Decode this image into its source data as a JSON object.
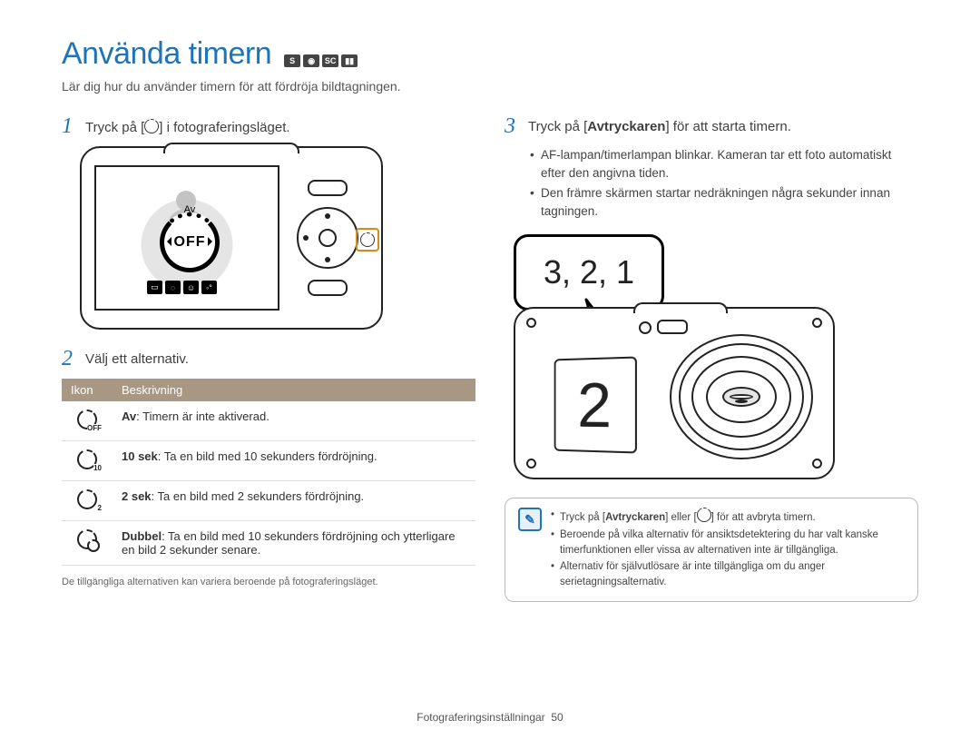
{
  "header": {
    "title": "Använda timern",
    "mode_icons": [
      "SMART",
      "camera-icon",
      "SCENE",
      "video-icon"
    ]
  },
  "intro": "Lär dig hur du använder timern för att fördröja bildtagningen.",
  "steps": {
    "s1": {
      "num": "1",
      "pre": "Tryck på [",
      "post": "] i fotograferingsläget."
    },
    "s2": {
      "num": "2",
      "text": "Välj ett alternativ."
    },
    "s3": {
      "num": "3",
      "pre": "Tryck på [",
      "bold": "Avtryckaren",
      "post": "] för att starta timern."
    }
  },
  "camera_back": {
    "av_label": "Av",
    "off_label": "OFF",
    "right_button_glyph": "t"
  },
  "bullets3": [
    "AF-lampan/timerlampan blinkar. Kameran tar ett foto automatiskt efter den angivna tiden.",
    "Den främre skärmen startar nedräkningen några sekunder innan tagningen."
  ],
  "countdown_bubble": "3, 2, 1",
  "front_display_value": "2",
  "table": {
    "headers": [
      "Ikon",
      "Beskrivning"
    ],
    "rows": [
      {
        "icon_sub": "OFF",
        "label": "Av",
        "desc": ": Timern är inte aktiverad."
      },
      {
        "icon_sub": "10",
        "label": "10 sek",
        "desc": ": Ta en bild med 10 sekunders fördröjning."
      },
      {
        "icon_sub": "2",
        "label": "2 sek",
        "desc": ": Ta en bild med 2 sekunders fördröjning."
      },
      {
        "icon_sub": "dbl",
        "label": "Dubbel",
        "desc": ": Ta en bild med 10 sekunders fördröjning och ytterligare en bild 2 sekunder senare."
      }
    ]
  },
  "footnote_left": "De tillgängliga alternativen kan variera beroende på fotograferingsläget.",
  "note": {
    "items": [
      {
        "pre": "Tryck på [",
        "bold": "Avtryckaren",
        "mid": "] eller [",
        "post": "] för att avbryta timern."
      },
      {
        "text": "Beroende på vilka alternativ för ansiktsdetektering du har valt kanske timerfunktionen eller vissa av alternativen inte är tillgängliga."
      },
      {
        "text": "Alternativ för självutlösare är inte tillgängliga om du anger serietagningsalternativ."
      }
    ]
  },
  "footer": {
    "section": "Fotograferingsinställningar",
    "page": "50"
  }
}
